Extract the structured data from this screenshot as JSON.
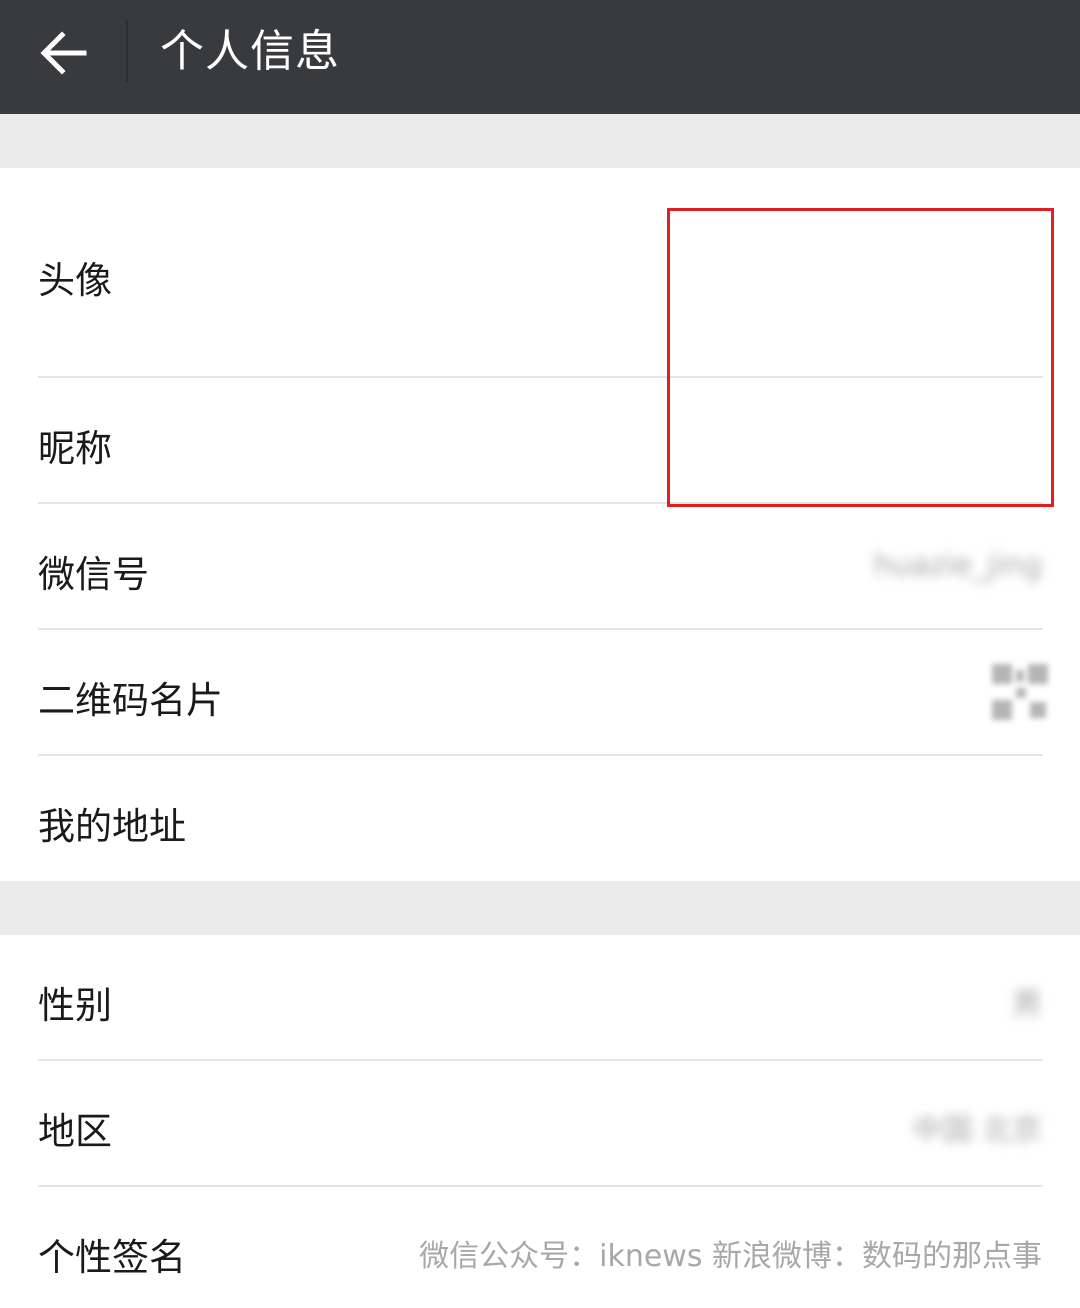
{
  "header": {
    "title": "个人信息",
    "back_icon": "arrow-left-icon",
    "background": "#393a3f"
  },
  "section1": {
    "rows": [
      {
        "label": "头像",
        "value": ""
      },
      {
        "label": "昵称",
        "value": ""
      },
      {
        "label": "微信号",
        "value": "huazie_jing"
      },
      {
        "label": "二维码名片",
        "value": "",
        "icon": "qr-code-icon"
      },
      {
        "label": "我的地址",
        "value": ""
      }
    ]
  },
  "section2": {
    "rows": [
      {
        "label": "性别",
        "value": "男"
      },
      {
        "label": "地区",
        "value": "中国 北京"
      },
      {
        "label": "个性签名",
        "value": "微信公众号：iknews  新浪微博：数码的那点事"
      }
    ]
  },
  "colors": {
    "highlight_border": "#e02020",
    "page_background": "#ebebeb"
  }
}
